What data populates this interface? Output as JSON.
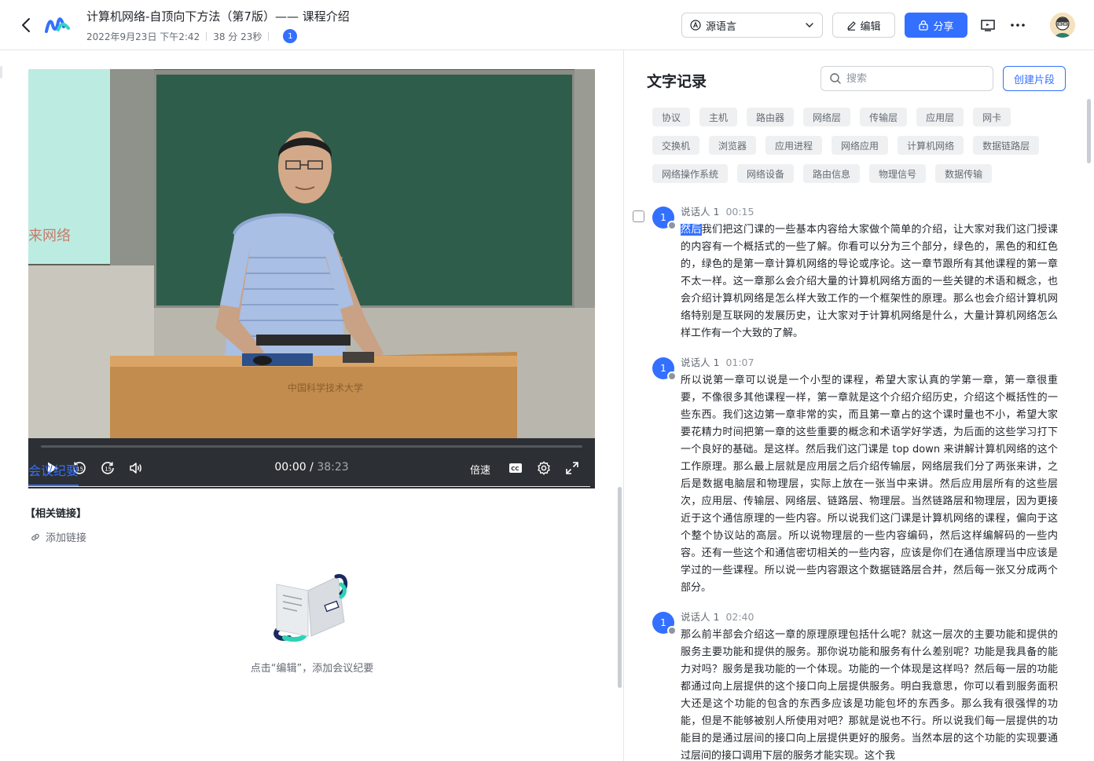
{
  "header": {
    "title": "计算机网络-自顶向下方法（第7版）—— 课程介绍",
    "date": "2022年9月23日 下午2:42",
    "duration": "38 分 23秒",
    "participants_count": "1",
    "language_label": "源语言",
    "edit_label": "编辑",
    "share_label": "分享",
    "accent_color": "#3370ff"
  },
  "player": {
    "current_time": "00:00",
    "separator": " / ",
    "total_time": "38:23",
    "speed_label": "倍速",
    "progress_percent": 0
  },
  "minutes": {
    "tab_label": "会议纪要",
    "links_heading": "【相关链接】",
    "add_link_label": "添加链接",
    "empty_text": "点击“编辑”，添加会议纪要"
  },
  "transcript": {
    "title": "文字记录",
    "search_placeholder": "搜索",
    "create_clip_label": "创建片段",
    "tags": [
      [
        "协议",
        "主机",
        "路由器",
        "网络层",
        "传输层",
        "应用层",
        "网卡"
      ],
      [
        "交换机",
        "浏览器",
        "应用进程",
        "网络应用",
        "计算机网络",
        "数据链路层"
      ],
      [
        "网络操作系统",
        "网络设备",
        "路由信息",
        "物理信号",
        "数据传输"
      ]
    ],
    "segments": [
      {
        "speaker": "说话人 1",
        "avatar_label": "1",
        "time": "00:15",
        "highlight": "然后",
        "text": "我们把这门课的一些基本内容给大家做个简单的介绍，让大家对我们这门授课的内容有一个概括式的一些了解。你看可以分为三个部分，绿色的，黑色的和红色的，绿色的是第一章计算机网络的导论或序论。这一章节跟所有其他课程的第一章不太一样。这一章那么会介绍大量的计算机网络方面的一些关键的术语和概念，也会介绍计算机网络是怎么样大致工作的一个框架性的原理。那么也会介绍计算机网络特别是互联网的发展历史，让大家对于计算机网络是什么，大量计算机网络怎么样工作有一个大致的了解。"
      },
      {
        "speaker": "说话人 1",
        "avatar_label": "1",
        "time": "01:07",
        "highlight": "",
        "text": "所以说第一章可以说是一个小型的课程，希望大家认真的学第一章，第一章很重要，不像很多其他课程一样，第一章就是这个介绍介绍历史，介绍这个概括性的一些东西。我们这边第一章非常的实，而且第一章占的这个课时量也不小，希望大家要花精力时间把第一章的这些重要的概念和术语学好学透，为后面的这些学习打下一个良好的基础。是这样。然后我们这门课是 top down 来讲解计算机网络的这个工作原理。那么最上层就是应用层之后介绍传输层，网络层我们分了两张来讲，之后是数据电脑层和物理层，实际上放在一张当中来讲。然后应用层所有的这些层次，应用层、传输层、网络层、链路层、物理层。当然链路层和物理层，因为更接近于这个通信原理的一些内容。所以说我们这门课是计算机网络的课程，偏向于这个整个协议站的高层。所以说物理层的一些内容编码，然后这样编解码的一些内容。还有一些这个和通信密切相关的一些内容，应该是你们在通信原理当中应该是学过的一些课程。所以说一些内容跟这个数据链路层合并，然后每一张又分成两个部分。"
      },
      {
        "speaker": "说话人 1",
        "avatar_label": "1",
        "time": "02:40",
        "highlight": "",
        "text": "那么前半部会介绍这一章的原理原理包括什么呢？就这一层次的主要功能和提供的服务主要功能和提供的服务。那你说功能和服务有什么差别呢？功能是我具备的能力对吗？服务是我功能的一个体现。功能的一个体现是这样吗？然后每一层的功能都通过向上层提供的这个接口向上层提供服务。明白我意思，你可以看到服务面积大还是这个功能的包含的东西多应该是功能包坏的东西多。那么我有很强悍的功能，但是不能够被别人所使用对吧？那就是说也不行。所以说我们每一层提供的功能目的是通过层间的接口向上层提供更好的服务。当然本层的这个功能的实现要通过层间的接口调用下层的服务才能实现。这个我"
      }
    ]
  }
}
